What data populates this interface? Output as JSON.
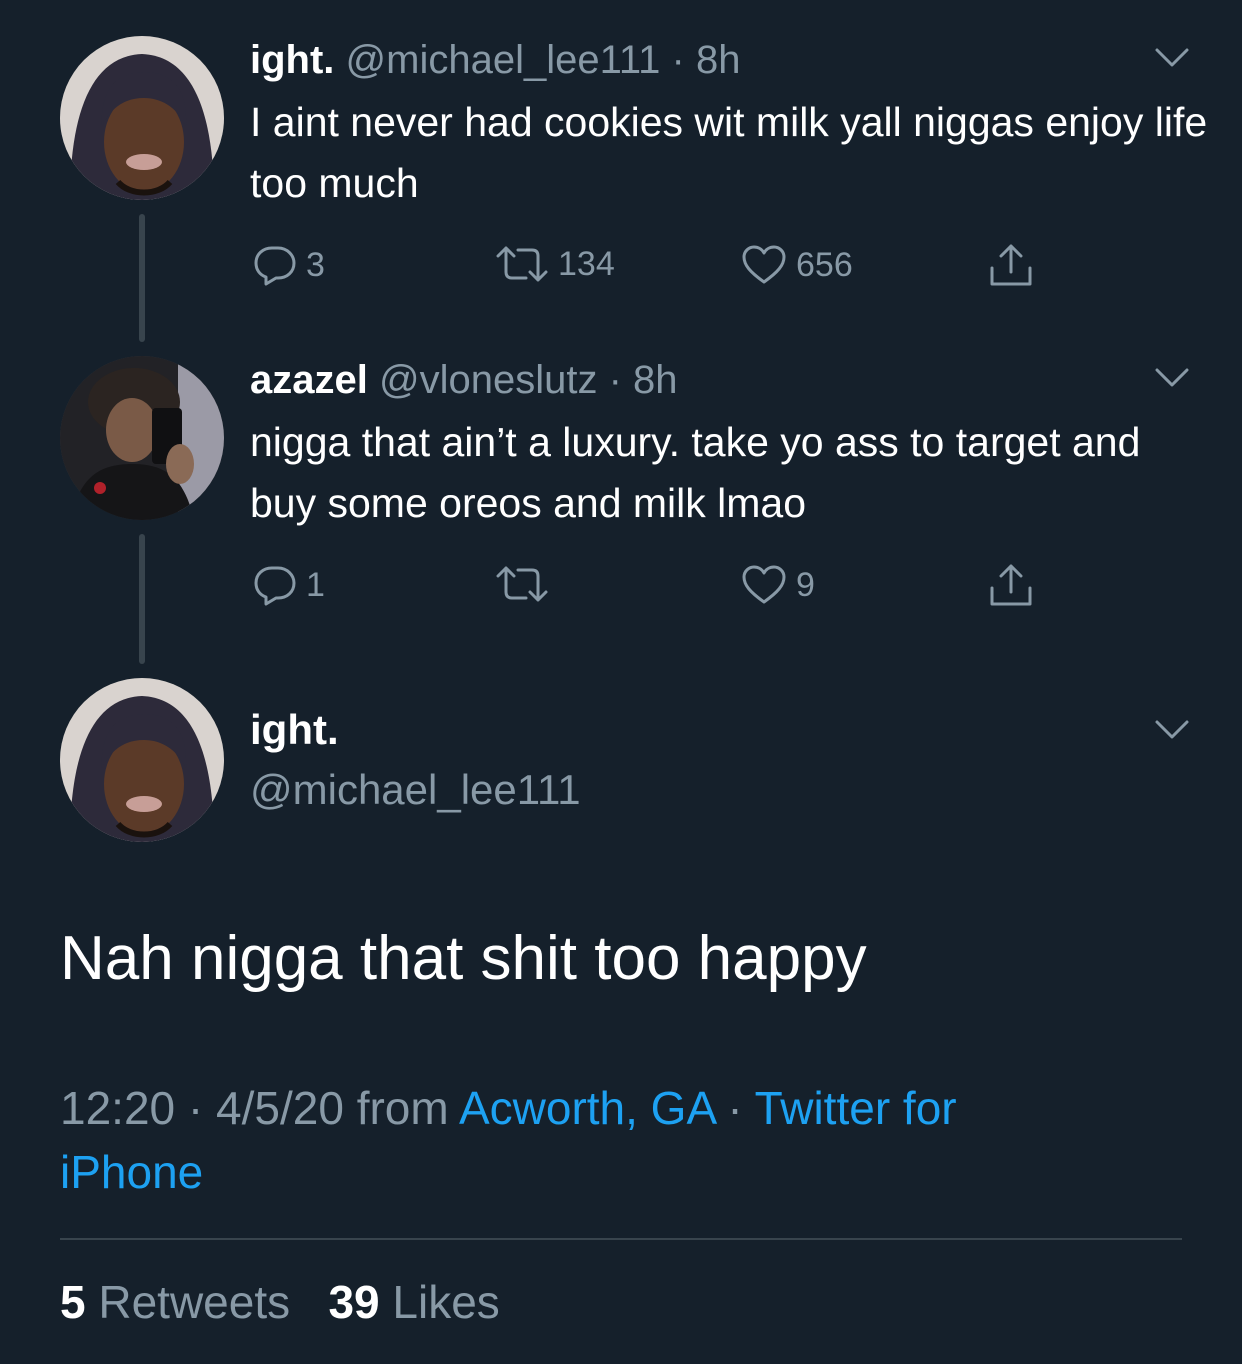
{
  "thread": [
    {
      "display_name": "ight.",
      "handle": "@michael_lee111",
      "sep": "·",
      "time": "8h",
      "text": "I aint never had cookies wit milk yall niggas enjoy life too much",
      "replies": "3",
      "retweets": "134",
      "likes": "656"
    },
    {
      "display_name": "azazel",
      "handle": "@vloneslutz",
      "sep": "·",
      "time": "8h",
      "text": "nigga that ain’t a luxury. take yo ass to target and buy some oreos and milk lmao",
      "replies": "1",
      "retweets": "",
      "likes": "9"
    }
  ],
  "main_tweet": {
    "display_name": "ight.",
    "handle": "@michael_lee111",
    "text": "Nah nigga that shit too happy",
    "time": "12:20",
    "sep1": " · ",
    "date": "4/5/20",
    "from_label": " from ",
    "location": "Acworth, GA",
    "sep2": " · ",
    "client": "Twitter for iPhone",
    "retweets_count": "5",
    "retweets_label": "Retweets",
    "likes_count": "39",
    "likes_label": "Likes"
  },
  "colors": {
    "background": "#15202b",
    "text": "#ffffff",
    "muted": "#8899a6",
    "link": "#1da1f2",
    "divider": "#38444d"
  },
  "icons": [
    "reply-icon",
    "retweet-icon",
    "like-icon",
    "share-icon",
    "chevron-down-icon"
  ]
}
